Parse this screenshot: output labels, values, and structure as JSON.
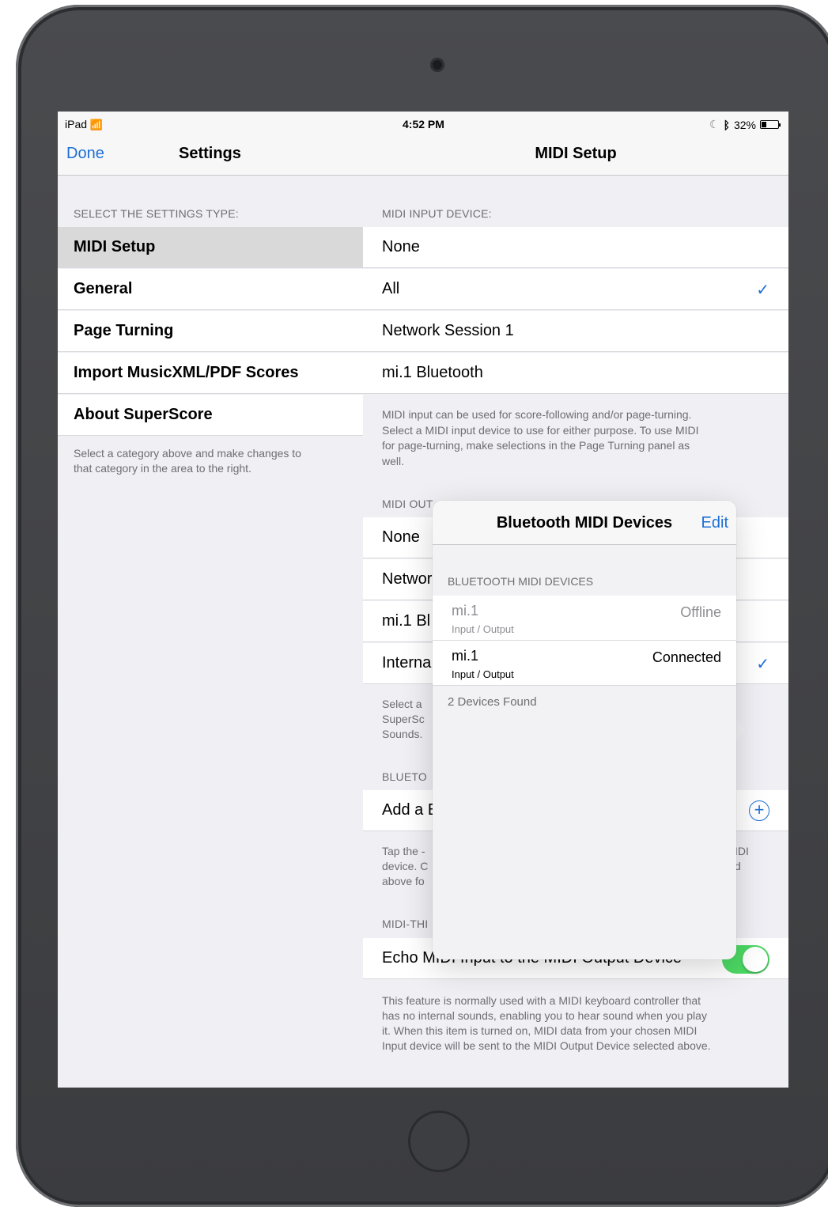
{
  "status_bar": {
    "carrier": "iPad",
    "time": "4:52 PM",
    "battery_text": "32%",
    "battery_level": 0.32
  },
  "master": {
    "done_label": "Done",
    "title": "Settings",
    "section_header": "SELECT THE SETTINGS TYPE:",
    "items": [
      {
        "label": "MIDI Setup"
      },
      {
        "label": "General"
      },
      {
        "label": "Page Turning"
      },
      {
        "label": "Import MusicXML/PDF Scores"
      },
      {
        "label": "About SuperScore"
      }
    ],
    "footer_line1": "Select a category above and make changes to",
    "footer_line2": "that category in the area to the right."
  },
  "detail": {
    "title": "MIDI Setup",
    "input_header": "MIDI INPUT DEVICE:",
    "input_items": [
      {
        "label": "None"
      },
      {
        "label": "All"
      },
      {
        "label": "Network Session 1"
      },
      {
        "label": "mi.1 Bluetooth"
      }
    ],
    "input_footer_lines": [
      "MIDI input can be used for score-following and/or page-turning.",
      "Select a MIDI input device to use for either purpose. To use MIDI",
      "for page-turning, make selections in the Page Turning panel as",
      "well."
    ],
    "output_header": "MIDI OUT",
    "output_items": [
      {
        "label": "None"
      },
      {
        "label": "Networ"
      },
      {
        "label": "mi.1 Bl"
      },
      {
        "label": "Interna"
      }
    ],
    "output_footer_lines": [
      "Select a",
      "SuperSc",
      "Sounds."
    ],
    "bluetooth_header": "BLUETO",
    "bluetooth_add_label": "Add a E",
    "bluetooth_footer_left": [
      "Tap the -",
      "device. C",
      "above fo"
    ],
    "bluetooth_footer_right": [
      "IDI",
      "d"
    ],
    "thru_header": "MIDI-THI",
    "echo_label": "Echo MIDI Input to the MIDI Output Device",
    "echo_on": true,
    "echo_footer_lines": [
      "This feature is normally used with a MIDI keyboard controller that",
      "has no internal sounds, enabling you to hear sound when you play",
      "it. When this item is turned on, MIDI data from your chosen MIDI",
      "Input device will be sent to the MIDI Output Device selected above."
    ]
  },
  "popover": {
    "title": "Bluetooth MIDI Devices",
    "edit_label": "Edit",
    "section_header": "BLUETOOTH MIDI DEVICES",
    "devices": [
      {
        "name": "mi.1",
        "type": "Input / Output",
        "state": "Offline"
      },
      {
        "name": "mi.1",
        "type": "Input / Output",
        "state": "Connected"
      }
    ],
    "found_text": "2 Devices Found"
  },
  "colors": {
    "accent": "#1d6fd6",
    "toggle_on": "#4cd964",
    "group_background": "#efeff4"
  },
  "icons": [
    "wifi-icon",
    "moon-icon",
    "bluetooth-icon",
    "battery-icon",
    "checkmark-icon",
    "add-circle-icon"
  ]
}
